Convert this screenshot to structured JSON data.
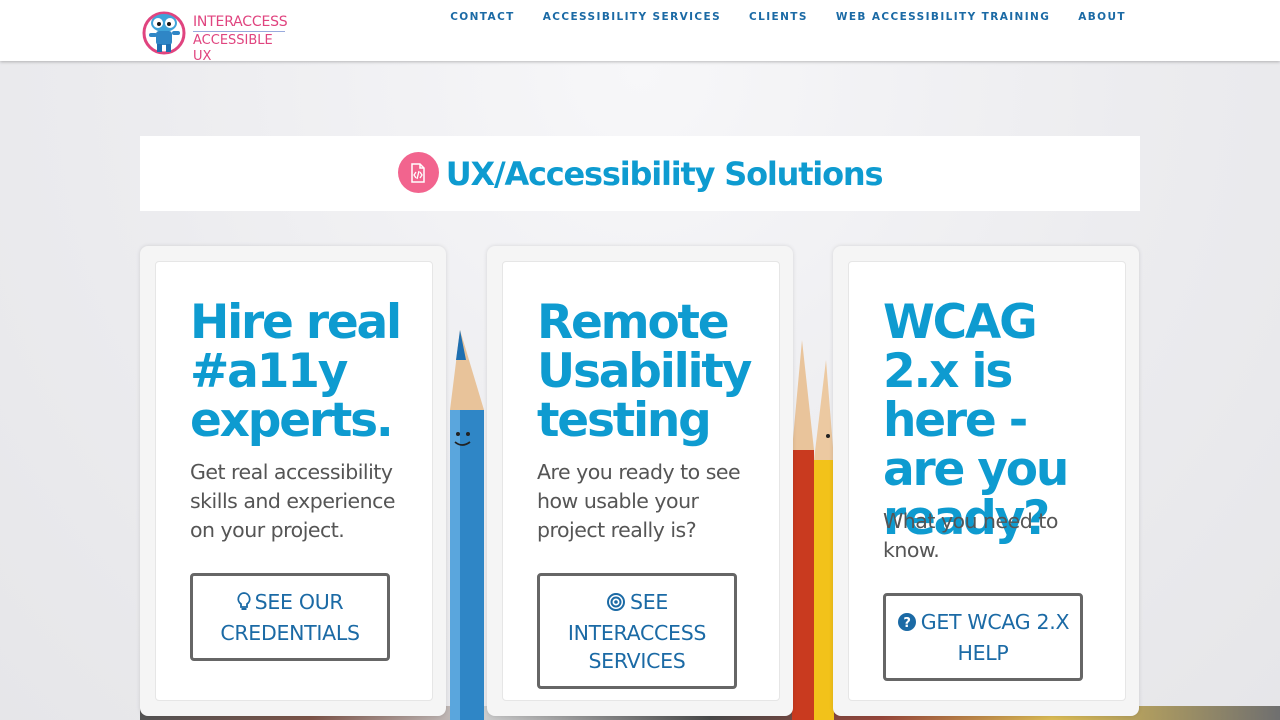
{
  "brand": {
    "line1": "INTERACCESS",
    "line2": "ACCESSIBLE UX",
    "logo_icon": "robot-mascot-icon",
    "pink": "#e0447f",
    "blue": "#1b6aa5"
  },
  "nav": {
    "items": [
      {
        "label": "CONTACT"
      },
      {
        "label": "ACCESSIBILITY SERVICES"
      },
      {
        "label": "CLIENTS"
      },
      {
        "label": "WEB ACCESSIBILITY TRAINING"
      },
      {
        "label": "ABOUT"
      }
    ]
  },
  "section": {
    "title": "UX/Accessibility Solutions",
    "title_icon": "code-file-icon",
    "title_color": "#0e9bd0",
    "icon_bg": "#f2648e"
  },
  "cards": [
    {
      "heading": "Hire real #a11y experts.",
      "description": "Get real accessibility skills and experience on your project.",
      "button_label": "SEE OUR CREDENTIALS",
      "button_icon": "lightbulb-icon"
    },
    {
      "heading": "Remote Usability testing",
      "description": "Are you ready to see how usable your project really is?",
      "button_label": "SEE INTERACCESS SERVICES",
      "button_icon": "target-icon"
    },
    {
      "heading": "WCAG 2.x is here - are you ready?",
      "description": "What you need to know.",
      "button_label": "GET WCAG 2.X HELP",
      "button_icon": "question-circle-icon"
    }
  ]
}
